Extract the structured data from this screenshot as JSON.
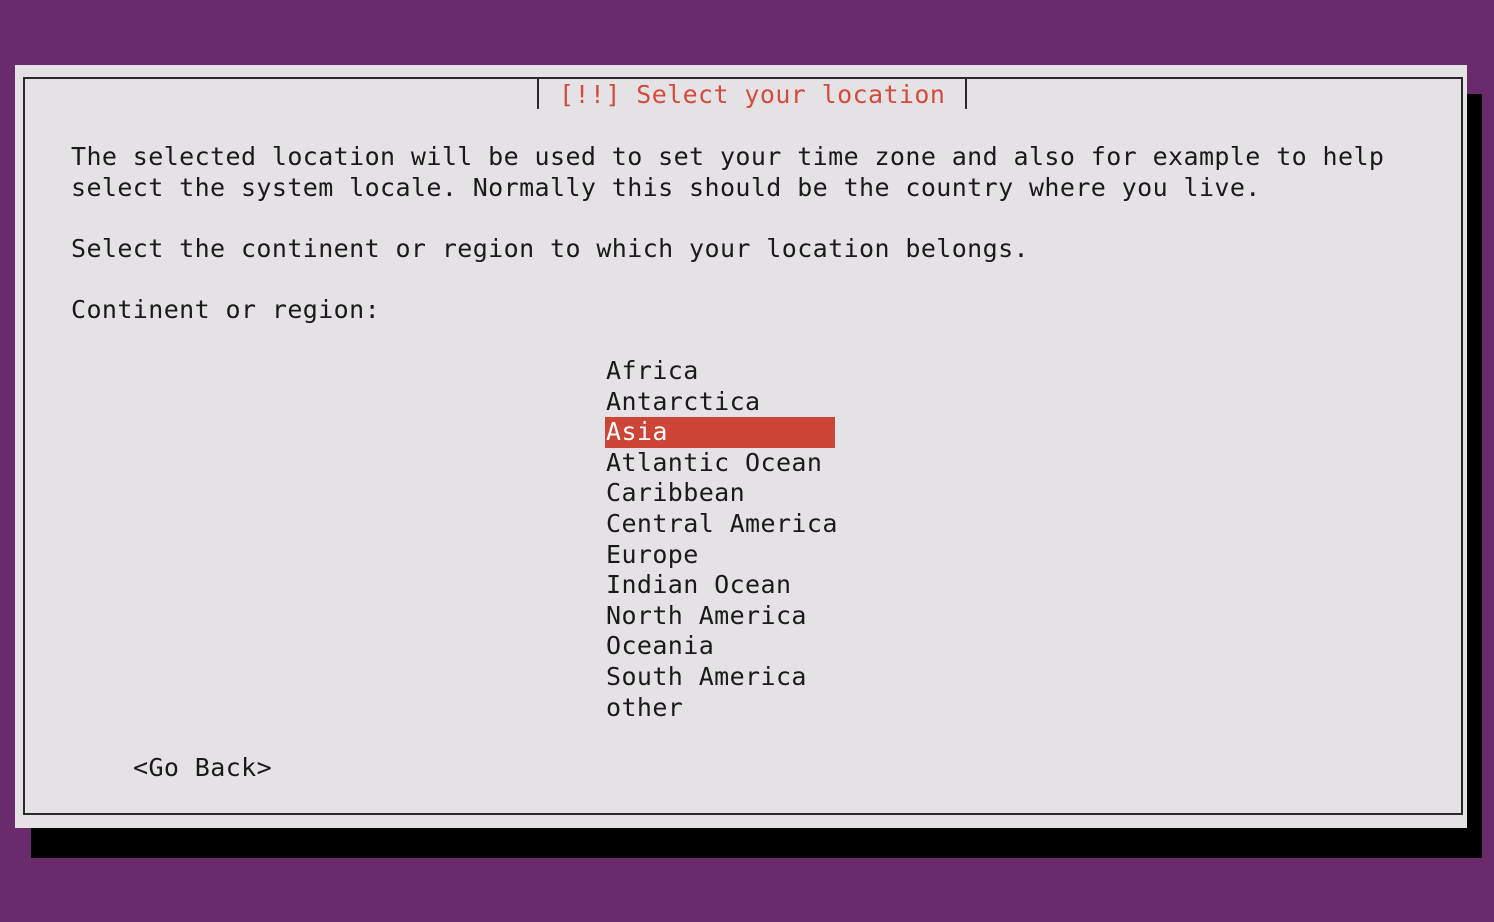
{
  "dialog": {
    "title": "[!!] Select your location",
    "description_line1": "The selected location will be used to set your time zone and also for example to help",
    "description_line2": "select the system locale. Normally this should be the country where you live.",
    "instruction": "Select the continent or region to which your location belongs.",
    "field_label": "Continent or region:",
    "options": [
      "Africa",
      "Antarctica",
      "Asia",
      "Atlantic Ocean",
      "Caribbean",
      "Central America",
      "Europe",
      "Indian Ocean",
      "North America",
      "Oceania",
      "South America",
      "other"
    ],
    "selected_index": 2,
    "go_back_label": "<Go Back>"
  },
  "colors": {
    "background": "#6a2b6c",
    "dialog": "#e5e2e5",
    "title": "#d24b3c",
    "selection": "#cc4536"
  }
}
